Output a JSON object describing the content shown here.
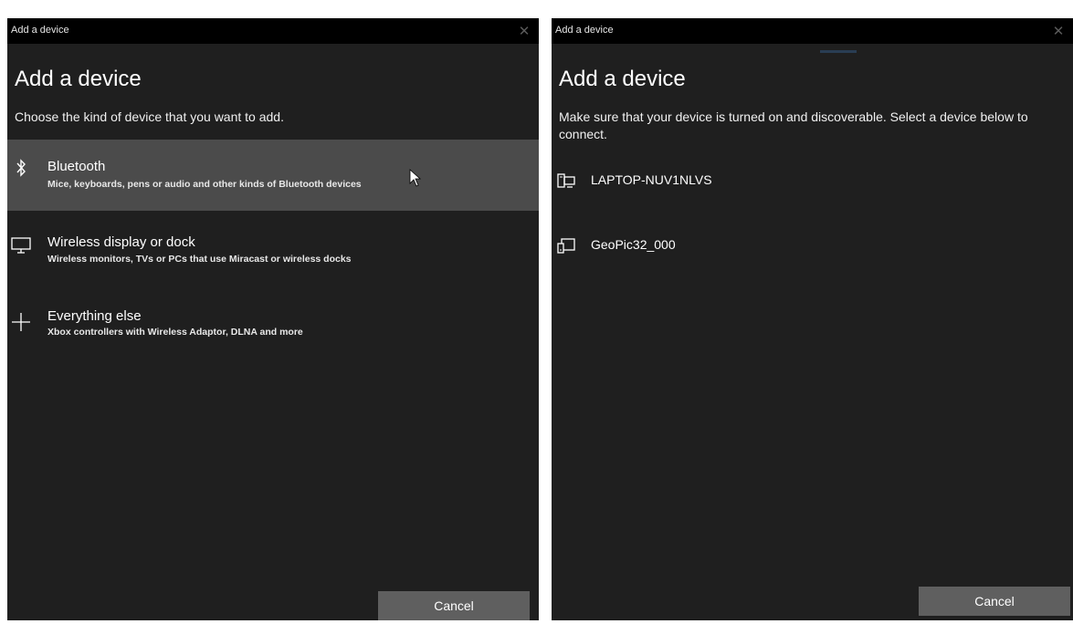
{
  "left_dialog": {
    "window_title": "Add a device",
    "heading": "Add a device",
    "subtext": "Choose the kind of device that you want to add.",
    "options": [
      {
        "name": "Bluetooth",
        "description": "Mice, keyboards, pens or audio and other kinds of Bluetooth devices",
        "icon": "bluetooth-icon",
        "selected": true
      },
      {
        "name": "Wireless display or dock",
        "description": "Wireless monitors, TVs or PCs that use Miracast or wireless docks",
        "icon": "monitor-icon",
        "selected": false
      },
      {
        "name": "Everything else",
        "description": "Xbox controllers with Wireless Adaptor, DLNA and more",
        "icon": "plus-icon",
        "selected": false
      }
    ],
    "cancel_label": "Cancel"
  },
  "right_dialog": {
    "window_title": "Add a device",
    "heading": "Add a device",
    "subtext": "Make sure that your device is turned on and discoverable. Select a device below to connect.",
    "devices": [
      {
        "label": "LAPTOP-NUV1NLVS",
        "icon": "computer-icon"
      },
      {
        "label": "GeoPic32_000",
        "icon": "media-device-icon"
      }
    ],
    "cancel_label": "Cancel"
  },
  "colors": {
    "titlebar": "#000000",
    "dialog_background": "#1f1f1f",
    "selected_row": "#4b4b4b",
    "button": "#5f5f5f",
    "text": "#ffffff"
  }
}
